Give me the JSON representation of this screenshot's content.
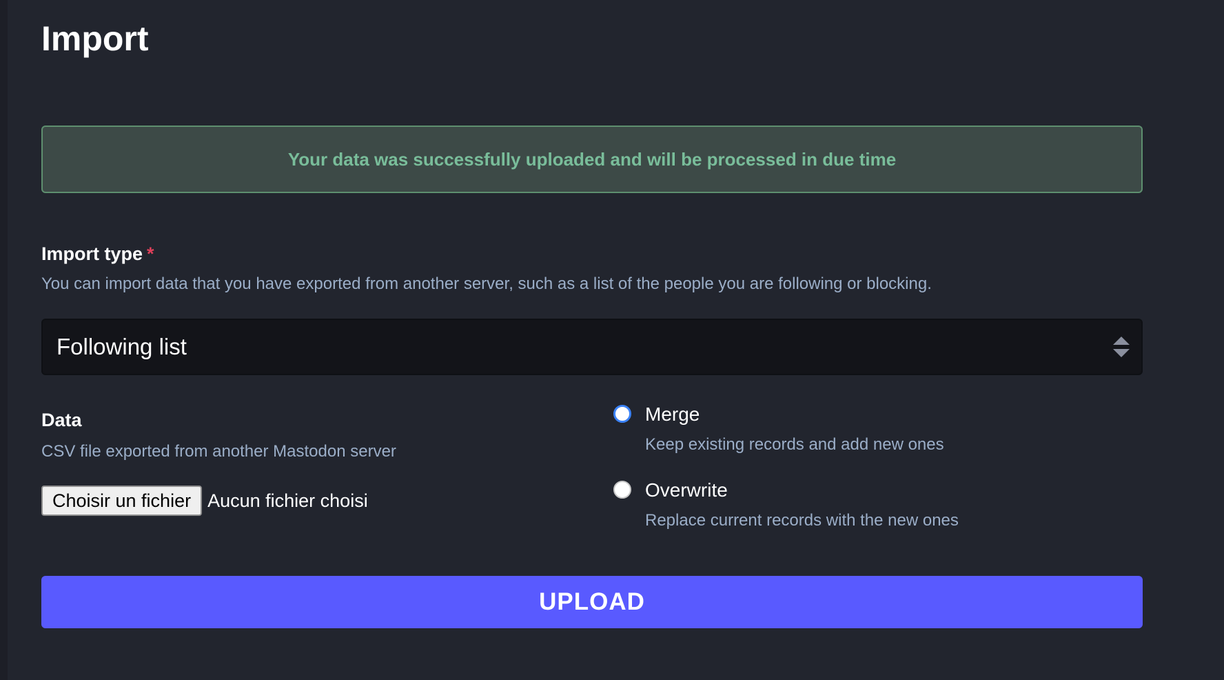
{
  "page": {
    "title": "Import"
  },
  "flash": {
    "message": "Your data was successfully uploaded and will be processed in due time"
  },
  "import_type": {
    "label": "Import type",
    "required_mark": "*",
    "hint": "You can import data that you have exported from another server, such as a list of the people you are following or blocking.",
    "selected_value": "Following list"
  },
  "data_field": {
    "label": "Data",
    "hint": "CSV file exported from another Mastodon server",
    "file_button_label": "Choisir un fichier",
    "file_status": "Aucun fichier choisi"
  },
  "mode": {
    "options": [
      {
        "label": "Merge",
        "hint": "Keep existing records and add new ones",
        "checked": true
      },
      {
        "label": "Overwrite",
        "hint": "Replace current records with the new ones",
        "checked": false
      }
    ]
  },
  "actions": {
    "upload_label": "UPLOAD"
  },
  "colors": {
    "background": "#22252e",
    "success_text": "#79bd9a",
    "accent": "#595aff",
    "hint_text": "#9baec8",
    "required": "#df405a",
    "radio_checked": "#3b82f6"
  }
}
